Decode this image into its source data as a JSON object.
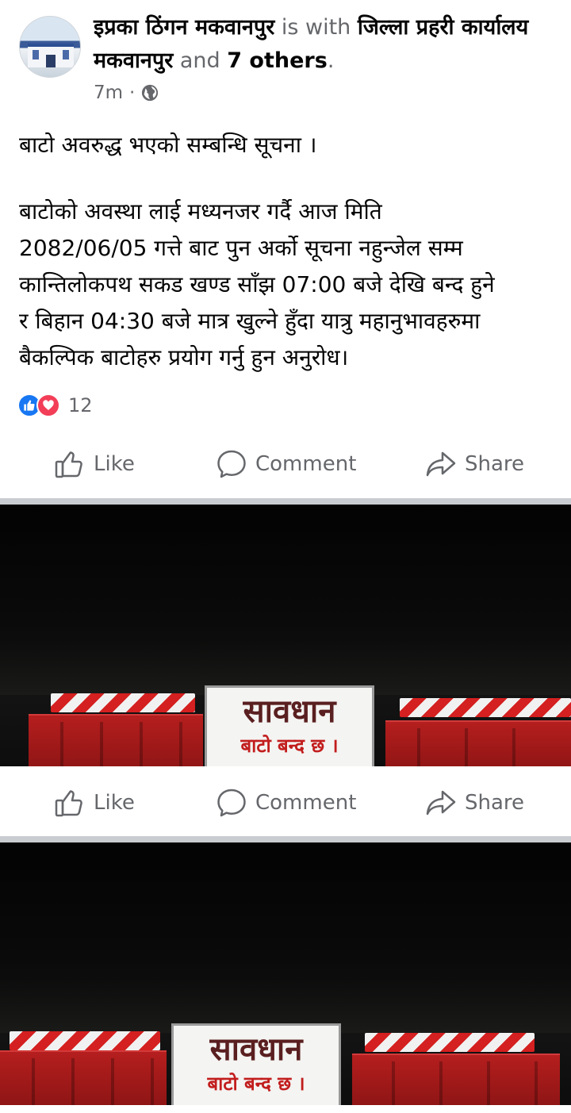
{
  "post": {
    "author": "इप्रका ठिंगन मकवानपुर",
    "with_text": "is with",
    "tagged": "जिल्ला प्रहरी कार्यालय मकवानपुर",
    "and_text": "and",
    "others": "7 others",
    "period": ".",
    "time": "7m",
    "separator": "·",
    "privacy_icon": "globe-icon",
    "lines": [
      "बाटो अवरुद्ध भएको सम्बन्धि सूचना ।",
      "बाटोको अवस्था लाई मध्यनजर गर्दै आज मिति",
      "2082/06/05 गत्ते बाट पुन अर्को सूचना नहुन्जेल सम्म",
      "कान्तिलोकपथ सकड खण्ड साँझ 07:00 बजे देखि बन्द हुने",
      "र बिहान 04:30 बजे मात्र खुल्ने हुँदा यात्रु महानुभावहरुमा",
      "बैकल्पिक बाटोहरु प्रयोग गर्नु हुन अनुरोध।"
    ],
    "reaction_count": "12"
  },
  "actions": {
    "like": "Like",
    "comment": "Comment",
    "share": "Share"
  },
  "photos": [
    {
      "sign_title": "सावधान",
      "sign_sub": "बाटो बन्द छ ।"
    },
    {
      "sign_title": "सावधान",
      "sign_sub": "बाटो बन्द छ ।"
    }
  ],
  "colors": {
    "facebook_blue": "#1877f2",
    "love_red": "#f33e58",
    "muted_text": "#65676b"
  }
}
